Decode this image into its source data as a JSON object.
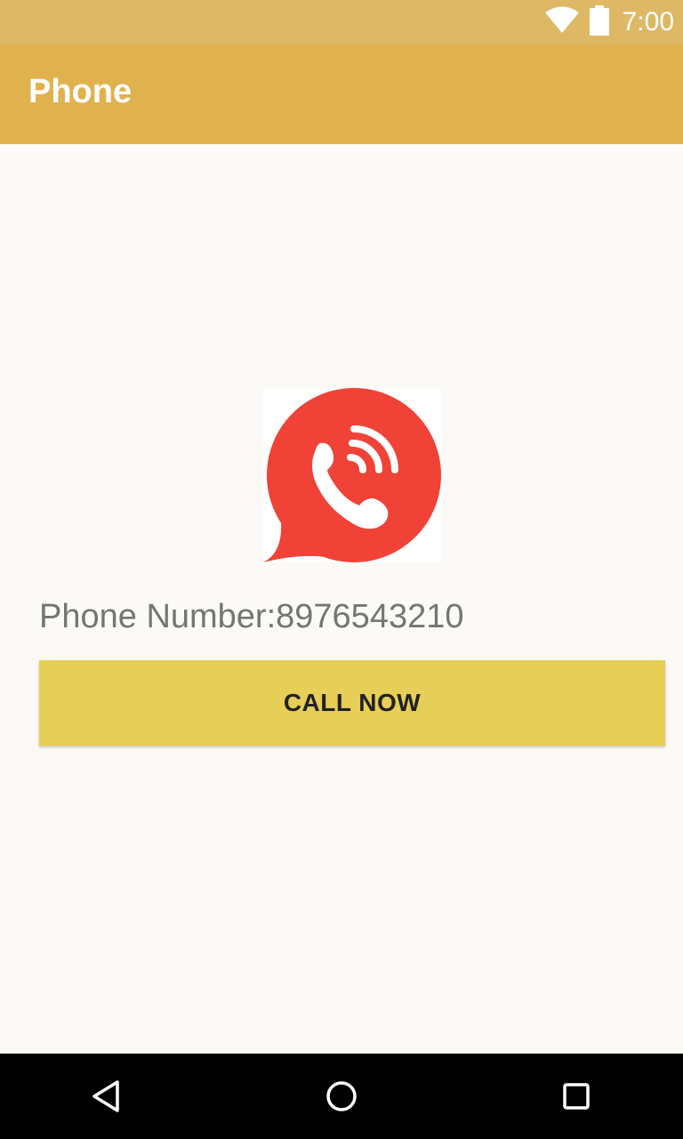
{
  "status_bar": {
    "time": "7:00",
    "icons": [
      "wifi-icon",
      "battery-icon"
    ]
  },
  "app_bar": {
    "title": "Phone"
  },
  "main": {
    "logo_icon": "phone-call-bubble-icon",
    "phone_label": "Phone Number:8976543210",
    "call_button_label": "CALL NOW"
  },
  "nav_bar": {
    "icons": [
      "back-icon",
      "home-icon",
      "recents-icon"
    ]
  },
  "colors": {
    "status_bar": "#dfb865",
    "app_bar": "#e0b24e",
    "button": "#e6ce57",
    "logo_red": "#f04237",
    "background": "#fbfaf6"
  }
}
